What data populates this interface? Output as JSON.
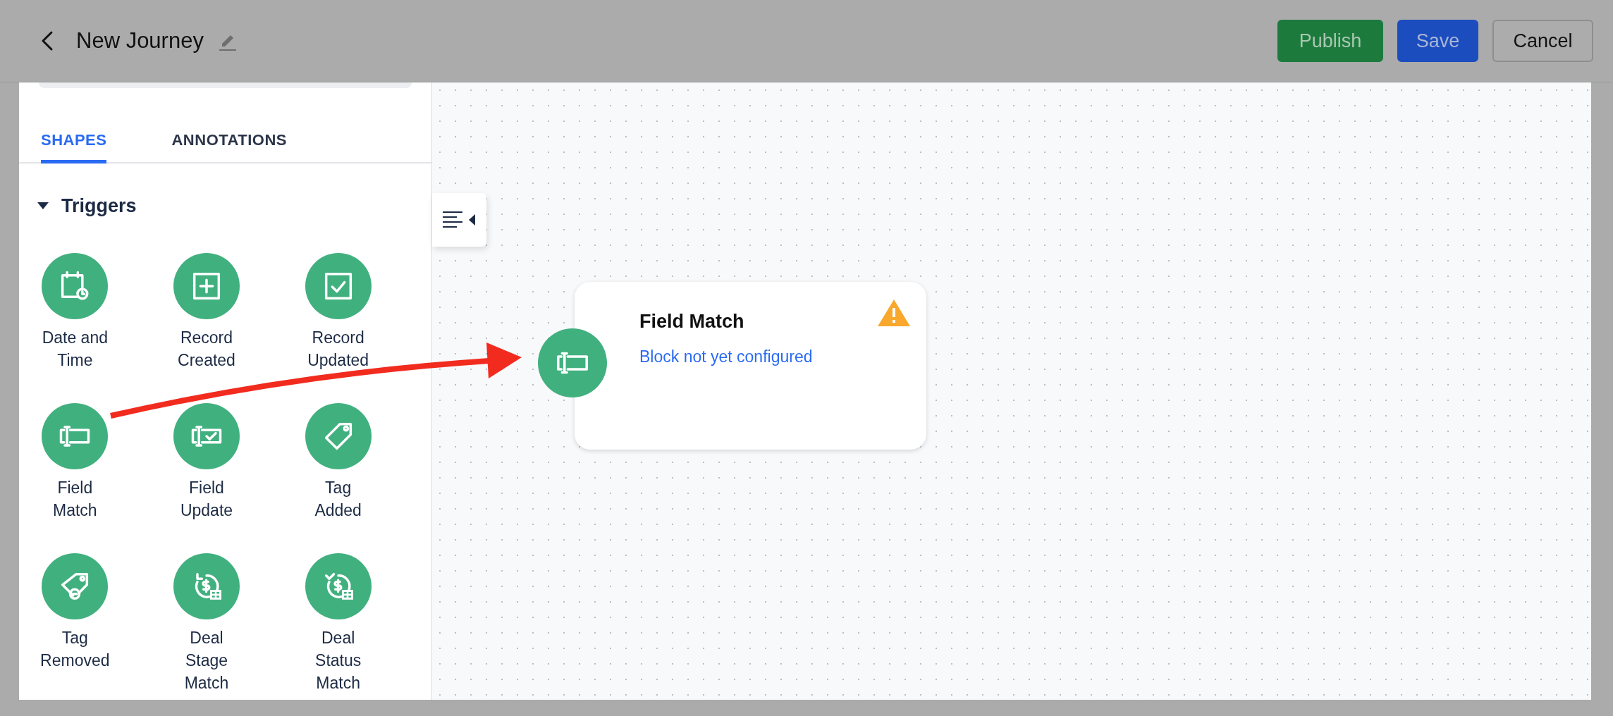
{
  "header": {
    "title": "New Journey",
    "buttons": [
      {
        "label": "Publish",
        "kind": "publish"
      },
      {
        "label": "Save",
        "kind": "save"
      },
      {
        "label": "Cancel",
        "kind": "cancel"
      }
    ]
  },
  "panel": {
    "tabs": [
      {
        "label": "SHAPES",
        "selected": true
      },
      {
        "label": "ANNOTATIONS",
        "selected": false
      }
    ],
    "section": {
      "title": "Triggers",
      "expanded": true,
      "items": [
        {
          "label": "Date and\nTime",
          "kind": "calendar"
        },
        {
          "label": "Record\nCreated",
          "kind": "plus"
        },
        {
          "label": "Record\nUpdated",
          "kind": "check"
        },
        {
          "label": "Field\nMatch",
          "kind": "field"
        },
        {
          "label": "Field\nUpdate",
          "kind": "fieldcheck"
        },
        {
          "label": "Tag\nAdded",
          "kind": "tag"
        },
        {
          "label": "Tag\nRemoved",
          "kind": "tagminus"
        },
        {
          "label": "Deal\nStage\nMatch",
          "kind": "dealstage"
        },
        {
          "label": "Deal\nStatus\nMatch",
          "kind": "dealstatus"
        }
      ]
    }
  },
  "canvas": {
    "node": {
      "title": "Field Match",
      "status": "Block not yet configured",
      "kind": "field",
      "warning": true
    }
  }
}
